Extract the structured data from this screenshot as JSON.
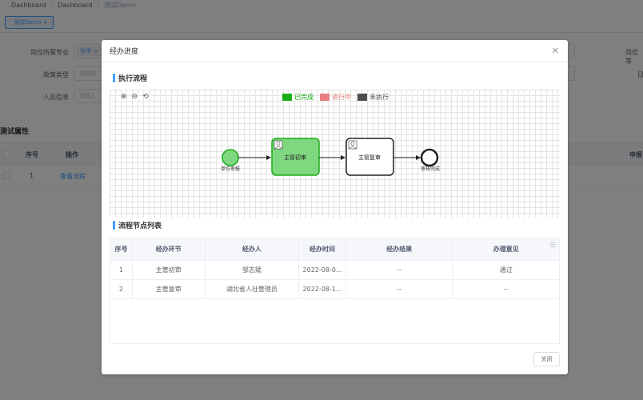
{
  "breadcrumb": [
    "Dashboard",
    "Dashboard",
    "测试Demo"
  ],
  "tag_button": {
    "label": "测试Demo"
  },
  "filters": {
    "major": {
      "label": "岗位所需专业",
      "chip": "哲学"
    },
    "policy": {
      "label": "政策类型",
      "placeholder": "请选择"
    },
    "person": {
      "label": "人员信息",
      "placeholder": "请输入"
    },
    "right_label_1": "岗位等",
    "right_label_2": "日"
  },
  "bg_section_title": "测试属性",
  "bg_table": {
    "headers": {
      "seq": "序号",
      "action": "操作",
      "apply": "申报"
    },
    "row": {
      "seq": "1",
      "action": "查看流程"
    }
  },
  "dialog": {
    "title": "经办进度",
    "close_icon": "close-icon",
    "flow_section": "执行流程",
    "zoom_in_icon": "zoom-in-icon",
    "zoom_out_icon": "zoom-out-icon",
    "reset_icon": "reset-icon",
    "legend": [
      {
        "label": "已完成",
        "color": "#1aad19"
      },
      {
        "label": "进行中",
        "color": "#e77f7f"
      },
      {
        "label": "未执行",
        "color": "#4d4d4d"
      }
    ],
    "flow": {
      "start_label": "单位审报",
      "task1_label": "主管初审",
      "task2_label": "主管复审",
      "end_label": "审核完成",
      "done_fill": "#7fd77f",
      "done_stroke": "#1aad19",
      "start_fill": "#7fd77f"
    },
    "list_section": "流程节点列表",
    "table": {
      "headers": [
        "序号",
        "经办环节",
        "经办人",
        "经办时间",
        "经办结果",
        "办理意见"
      ],
      "rows": [
        [
          "1",
          "主管初审",
          "邹志斌",
          "2022-08-0...",
          "--",
          "通过"
        ],
        [
          "2",
          "主管复审",
          "湖北省人社管理员",
          "2022-08-1...",
          "--",
          "--"
        ]
      ]
    },
    "close_button": "关闭"
  }
}
